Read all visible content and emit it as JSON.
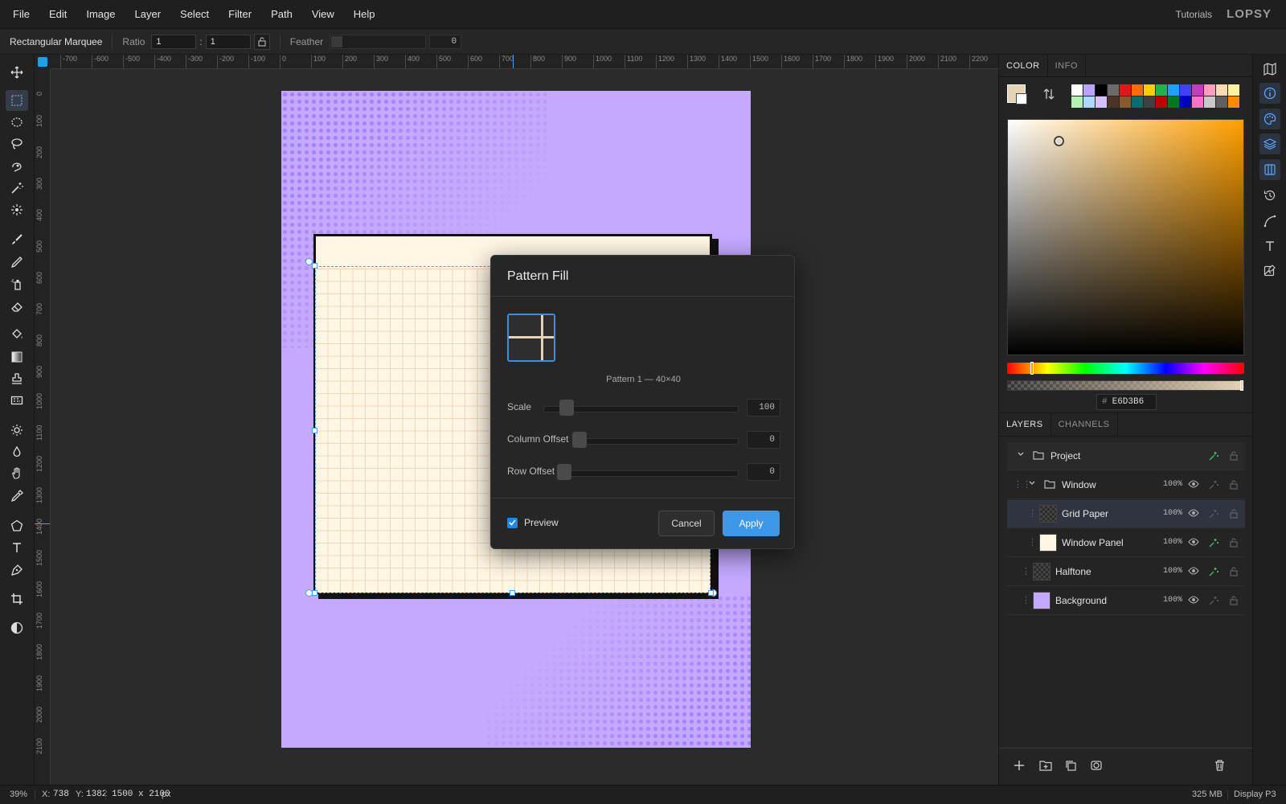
{
  "menubar": {
    "items": [
      "File",
      "Edit",
      "Image",
      "Layer",
      "Select",
      "Filter",
      "Path",
      "View",
      "Help"
    ],
    "tutorials": "Tutorials",
    "logo": "LOPSY"
  },
  "options": {
    "tool_name": "Rectangular Marquee",
    "ratio_label": "Ratio",
    "ratio_w": "1",
    "ratio_sep": ":",
    "ratio_h": "1",
    "feather_label": "Feather",
    "feather_value": "0"
  },
  "rulers": {
    "top": [
      "-700",
      "-600",
      "-500",
      "-400",
      "-300",
      "-200",
      "-100",
      "0",
      "100",
      "200",
      "300",
      "400",
      "500",
      "600",
      "700",
      "800",
      "900",
      "1000",
      "1100",
      "1200",
      "1300",
      "1400",
      "1500",
      "1600",
      "1700",
      "1800",
      "1900",
      "2000",
      "2100",
      "2200"
    ],
    "left": [
      "0",
      "100",
      "200",
      "300",
      "400",
      "500",
      "600",
      "700",
      "800",
      "900",
      "1000",
      "1100",
      "1200",
      "1300",
      "1400",
      "1500",
      "1600",
      "1700",
      "1800",
      "1900",
      "2000",
      "2100"
    ]
  },
  "dialog": {
    "title": "Pattern Fill",
    "pattern_caption": "Pattern 1 — 40×40",
    "scale_label": "Scale",
    "scale_value": "100",
    "column_offset_label": "Column Offset",
    "column_offset_value": "0",
    "row_offset_label": "Row Offset",
    "row_offset_value": "0",
    "preview_label": "Preview",
    "preview_checked": true,
    "cancel_label": "Cancel",
    "apply_label": "Apply"
  },
  "color_panel": {
    "tabs": [
      "COLOR",
      "INFO"
    ],
    "foreground": "#E6D3B6",
    "background": "#FFFFFF",
    "hex_label": "#",
    "hex_value": "E6D3B6",
    "palette": [
      "#ffffff",
      "#b9a4ff",
      "#000000",
      "#6b6b6b",
      "#e01818",
      "#ff6a00",
      "#ffcc00",
      "#22b14c",
      "#1ea0ff",
      "#4040ff",
      "#c03cc0",
      "#ff9fc0",
      "#ffd9b3",
      "#fff3a0",
      "#b4f0b4",
      "#b0d8ff",
      "#d6c0ff",
      "#4a3426",
      "#8a5a2e",
      "#0f6b6b",
      "#404040",
      "#c00000",
      "#00781e",
      "#0000c0",
      "#ff70c8",
      "#c8c8c8",
      "#606060",
      "#ff8c00"
    ]
  },
  "layers_panel": {
    "tabs": [
      "LAYERS",
      "CHANNELS"
    ],
    "layers": [
      {
        "name": "Project",
        "opacity": ""
      },
      {
        "name": "Window",
        "opacity": "100%"
      },
      {
        "name": "Grid Paper",
        "opacity": "100%"
      },
      {
        "name": "Window Panel",
        "opacity": "100%"
      },
      {
        "name": "Halftone",
        "opacity": "100%"
      },
      {
        "name": "Background",
        "opacity": "100%"
      }
    ]
  },
  "status": {
    "zoom": "39%",
    "coords_x_label": "X:",
    "coords_x": "738",
    "coords_y_label": "Y:",
    "coords_y": "1382",
    "doc_size": "1500 x 2100",
    "doc_unit": "px",
    "memory": "325 MB",
    "color_profile": "Display P3"
  },
  "colors": {
    "accent": "#3d97eb",
    "document_bg": "#c4a9ff",
    "halftone": "#a083ff",
    "panel_cream": "#fff6e4"
  }
}
